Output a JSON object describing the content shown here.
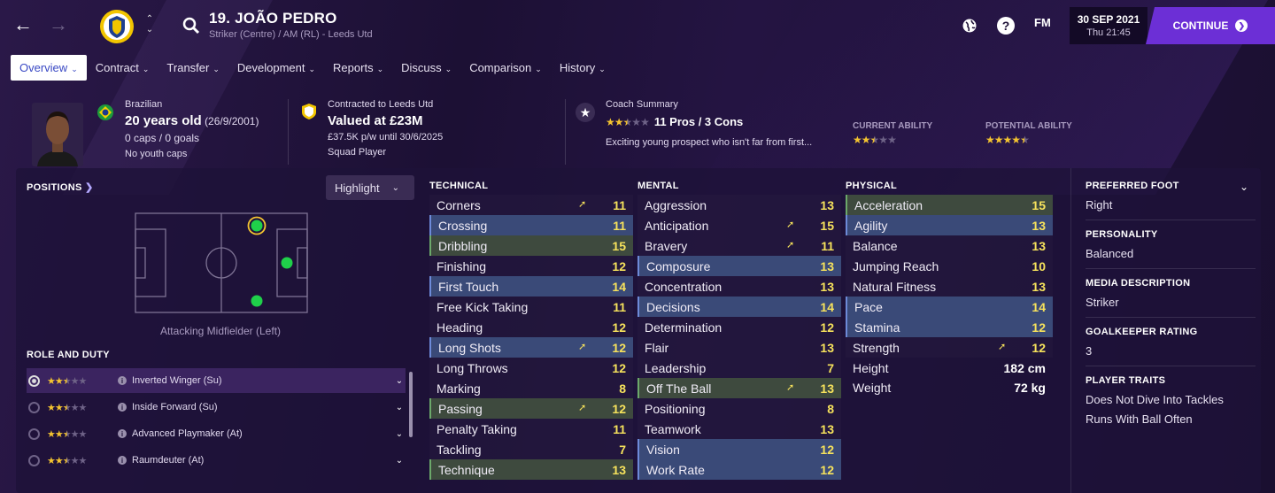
{
  "header": {
    "player_name": "19. JOÃO PEDRO",
    "player_sub": "Striker (Centre) / AM (RL) - Leeds Utd",
    "fm_label": "FM",
    "date": "30 SEP 2021",
    "time": "Thu 21:45",
    "continue_label": "CONTINUE"
  },
  "tabs": [
    {
      "label": "Overview"
    },
    {
      "label": "Contract"
    },
    {
      "label": "Transfer"
    },
    {
      "label": "Development"
    },
    {
      "label": "Reports"
    },
    {
      "label": "Discuss"
    },
    {
      "label": "Comparison"
    },
    {
      "label": "History"
    }
  ],
  "info": {
    "nationality": "Brazilian",
    "age": "20 years old",
    "dob": "(26/9/2001)",
    "caps": "0 caps / 0 goals",
    "youth_caps": "No youth caps",
    "contract_title": "Contracted to Leeds Utd",
    "value": "Valued at £23M",
    "wage": "£37.5K p/w until 30/6/2025",
    "squad_status": "Squad Player",
    "coach_title": "Coach Summary",
    "pros_cons": "11 Pros / 3 Cons",
    "coach_text": "Exciting young prospect who isn't far from first...",
    "current_ability_label": "CURRENT ABILITY",
    "potential_ability_label": "POTENTIAL ABILITY",
    "coach_stars": 2.5,
    "current_ability_stars": 2.5,
    "potential_ability_stars": 4.5
  },
  "positions": {
    "heading": "POSITIONS",
    "highlight_label": "Highlight",
    "caption": "Attacking Midfielder (Left)"
  },
  "roles": {
    "heading": "ROLE AND DUTY",
    "items": [
      {
        "name": "Inverted Winger (Su)",
        "stars": 2.5
      },
      {
        "name": "Inside Forward (Su)",
        "stars": 2.5
      },
      {
        "name": "Advanced Playmaker (At)",
        "stars": 2.5
      },
      {
        "name": "Raumdeuter (At)",
        "stars": 2.5
      }
    ]
  },
  "technical": {
    "heading": "TECHNICAL",
    "items": [
      {
        "name": "Corners",
        "value": "11",
        "style": "dark",
        "arrow": true
      },
      {
        "name": "Crossing",
        "value": "11",
        "style": "blue",
        "arrow": false
      },
      {
        "name": "Dribbling",
        "value": "15",
        "style": "green",
        "arrow": false
      },
      {
        "name": "Finishing",
        "value": "12",
        "style": "dark",
        "arrow": false
      },
      {
        "name": "First Touch",
        "value": "14",
        "style": "blue",
        "arrow": false
      },
      {
        "name": "Free Kick Taking",
        "value": "11",
        "style": "dark",
        "arrow": false
      },
      {
        "name": "Heading",
        "value": "12",
        "style": "dark",
        "arrow": false
      },
      {
        "name": "Long Shots",
        "value": "12",
        "style": "blue",
        "arrow": true
      },
      {
        "name": "Long Throws",
        "value": "12",
        "style": "dark",
        "arrow": false
      },
      {
        "name": "Marking",
        "value": "8",
        "style": "dark",
        "arrow": false
      },
      {
        "name": "Passing",
        "value": "12",
        "style": "green",
        "arrow": true
      },
      {
        "name": "Penalty Taking",
        "value": "11",
        "style": "dark",
        "arrow": false
      },
      {
        "name": "Tackling",
        "value": "7",
        "style": "dark",
        "arrow": false
      },
      {
        "name": "Technique",
        "value": "13",
        "style": "green",
        "arrow": false
      }
    ]
  },
  "mental": {
    "heading": "MENTAL",
    "items": [
      {
        "name": "Aggression",
        "value": "13",
        "style": "dark",
        "arrow": false
      },
      {
        "name": "Anticipation",
        "value": "15",
        "style": "dark",
        "arrow": true
      },
      {
        "name": "Bravery",
        "value": "11",
        "style": "dark",
        "arrow": true
      },
      {
        "name": "Composure",
        "value": "13",
        "style": "blue",
        "arrow": false
      },
      {
        "name": "Concentration",
        "value": "13",
        "style": "dark",
        "arrow": false
      },
      {
        "name": "Decisions",
        "value": "14",
        "style": "blue",
        "arrow": false
      },
      {
        "name": "Determination",
        "value": "12",
        "style": "dark",
        "arrow": false
      },
      {
        "name": "Flair",
        "value": "13",
        "style": "dark",
        "arrow": false
      },
      {
        "name": "Leadership",
        "value": "7",
        "style": "dark",
        "arrow": false
      },
      {
        "name": "Off The Ball",
        "value": "13",
        "style": "green",
        "arrow": true
      },
      {
        "name": "Positioning",
        "value": "8",
        "style": "dark",
        "arrow": false
      },
      {
        "name": "Teamwork",
        "value": "13",
        "style": "dark",
        "arrow": false
      },
      {
        "name": "Vision",
        "value": "12",
        "style": "blue",
        "arrow": false
      },
      {
        "name": "Work Rate",
        "value": "12",
        "style": "blue",
        "arrow": false
      }
    ]
  },
  "physical": {
    "heading": "PHYSICAL",
    "items": [
      {
        "name": "Acceleration",
        "value": "15",
        "style": "green",
        "arrow": false
      },
      {
        "name": "Agility",
        "value": "13",
        "style": "blue",
        "arrow": false
      },
      {
        "name": "Balance",
        "value": "13",
        "style": "dark",
        "arrow": false
      },
      {
        "name": "Jumping Reach",
        "value": "10",
        "style": "dark",
        "arrow": false
      },
      {
        "name": "Natural Fitness",
        "value": "13",
        "style": "dark",
        "arrow": false
      },
      {
        "name": "Pace",
        "value": "14",
        "style": "blue",
        "arrow": false
      },
      {
        "name": "Stamina",
        "value": "12",
        "style": "blue",
        "arrow": false
      },
      {
        "name": "Strength",
        "value": "12",
        "style": "dark",
        "arrow": true
      }
    ],
    "height_label": "Height",
    "height": "182 cm",
    "weight_label": "Weight",
    "weight": "72 kg"
  },
  "sidebar": {
    "preferred_foot_label": "PREFERRED FOOT",
    "preferred_foot": "Right",
    "personality_label": "PERSONALITY",
    "personality": "Balanced",
    "media_label": "MEDIA DESCRIPTION",
    "media": "Striker",
    "gk_label": "GOALKEEPER RATING",
    "gk": "3",
    "traits_label": "PLAYER TRAITS",
    "traits": [
      "Does Not Dive Into Tackles",
      "Runs With Ball Often"
    ]
  },
  "colors": {
    "accent": "#6c2fd6",
    "attribute_value": "#f6e25c",
    "star": "#f4c430",
    "position_dot": "#1fd04a"
  }
}
